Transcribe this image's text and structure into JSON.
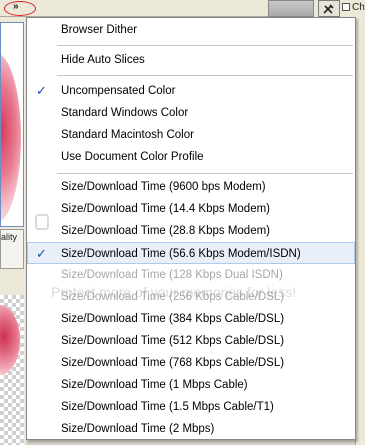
{
  "topbar": {
    "expand_glyph": "»",
    "right_label": "Ch"
  },
  "left_panel": {
    "quality_label": "ality"
  },
  "menu": {
    "groups": [
      {
        "items": [
          {
            "label": "Browser Dither",
            "checked": false,
            "enabled": true
          }
        ]
      },
      {
        "items": [
          {
            "label": "Hide Auto Slices",
            "checked": false,
            "enabled": true
          }
        ]
      },
      {
        "items": [
          {
            "label": "Uncompensated Color",
            "checked": true,
            "enabled": true
          },
          {
            "label": "Standard Windows Color",
            "checked": false,
            "enabled": true
          },
          {
            "label": "Standard Macintosh Color",
            "checked": false,
            "enabled": true
          },
          {
            "label": "Use Document Color Profile",
            "checked": false,
            "enabled": true
          }
        ]
      },
      {
        "items": [
          {
            "label": "Size/Download Time (9600 bps Modem)",
            "checked": false,
            "enabled": true
          },
          {
            "label": "Size/Download Time (14.4 Kbps Modem)",
            "checked": false,
            "enabled": true
          },
          {
            "label": "Size/Download Time (28.8 Kbps Modem)",
            "checked": false,
            "enabled": true
          },
          {
            "label": "Size/Download Time (56.6 Kbps Modem/ISDN)",
            "checked": true,
            "enabled": true
          },
          {
            "label": "Size/Download Time (128 Kbps Dual ISDN)",
            "checked": false,
            "enabled": false
          },
          {
            "label": "Size/Download Time (256 Kbps Cable/DSL)",
            "checked": false,
            "enabled": false
          },
          {
            "label": "Size/Download Time (384 Kbps Cable/DSL)",
            "checked": false,
            "enabled": true
          },
          {
            "label": "Size/Download Time (512 Kbps Cable/DSL)",
            "checked": false,
            "enabled": true
          },
          {
            "label": "Size/Download Time (768 Kbps Cable/DSL)",
            "checked": false,
            "enabled": true
          },
          {
            "label": "Size/Download Time (1 Mbps Cable)",
            "checked": false,
            "enabled": true
          },
          {
            "label": "Size/Download Time (1.5 Mbps Cable/T1)",
            "checked": false,
            "enabled": true
          },
          {
            "label": "Size/Download Time (2 Mbps)",
            "checked": false,
            "enabled": true
          }
        ]
      }
    ],
    "check_glyph": "✓",
    "selected_item": "Size/Download Time (56.6 Kbps Modem/ISDN)"
  },
  "watermark": {
    "text": "Protect more of your memories for less!"
  },
  "colors": {
    "highlight_fill": "#e8eff9",
    "highlight_border": "#aecaf0",
    "check": "#1b4fb0",
    "disabled_text": "#a7a7a7",
    "annotation_circle": "#e0202a"
  }
}
